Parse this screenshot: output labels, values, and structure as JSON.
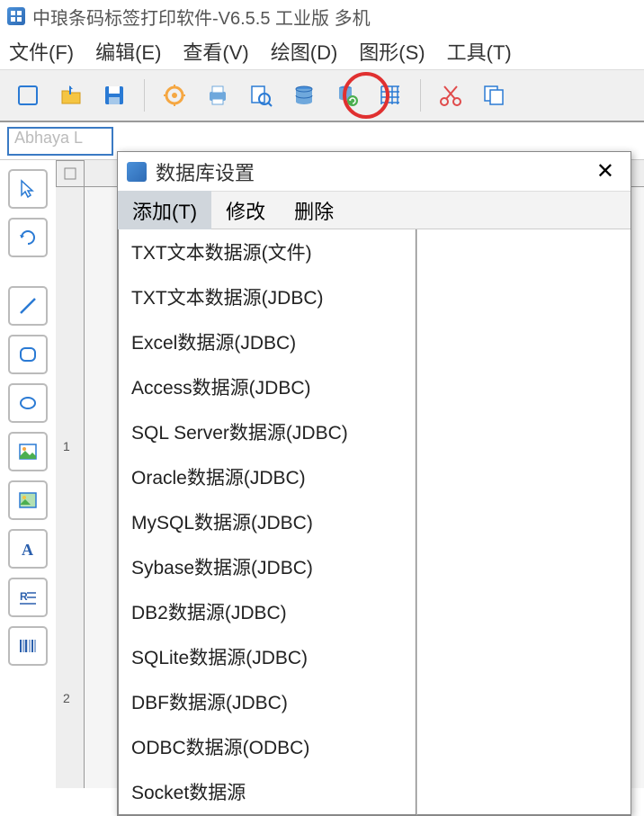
{
  "title": "中琅条码标签打印软件-V6.5.5 工业版 多机",
  "menu": {
    "file": "文件(F)",
    "edit": "编辑(E)",
    "view": "查看(V)",
    "draw": "绘图(D)",
    "shape": "图形(S)",
    "tool": "工具(T)"
  },
  "font_placeholder": "Abhaya L",
  "dialog": {
    "title": "数据库设置",
    "menu": {
      "add": "添加(T)",
      "modify": "修改",
      "delete": "删除"
    },
    "items": [
      "TXT文本数据源(文件)",
      "TXT文本数据源(JDBC)",
      "Excel数据源(JDBC)",
      "Access数据源(JDBC)",
      "SQL Server数据源(JDBC)",
      "Oracle数据源(JDBC)",
      "MySQL数据源(JDBC)",
      "Sybase数据源(JDBC)",
      "DB2数据源(JDBC)",
      "SQLite数据源(JDBC)",
      "DBF数据源(JDBC)",
      "ODBC数据源(ODBC)",
      "Socket数据源"
    ]
  },
  "ruler": {
    "mark1": "1",
    "mark2": "2"
  }
}
